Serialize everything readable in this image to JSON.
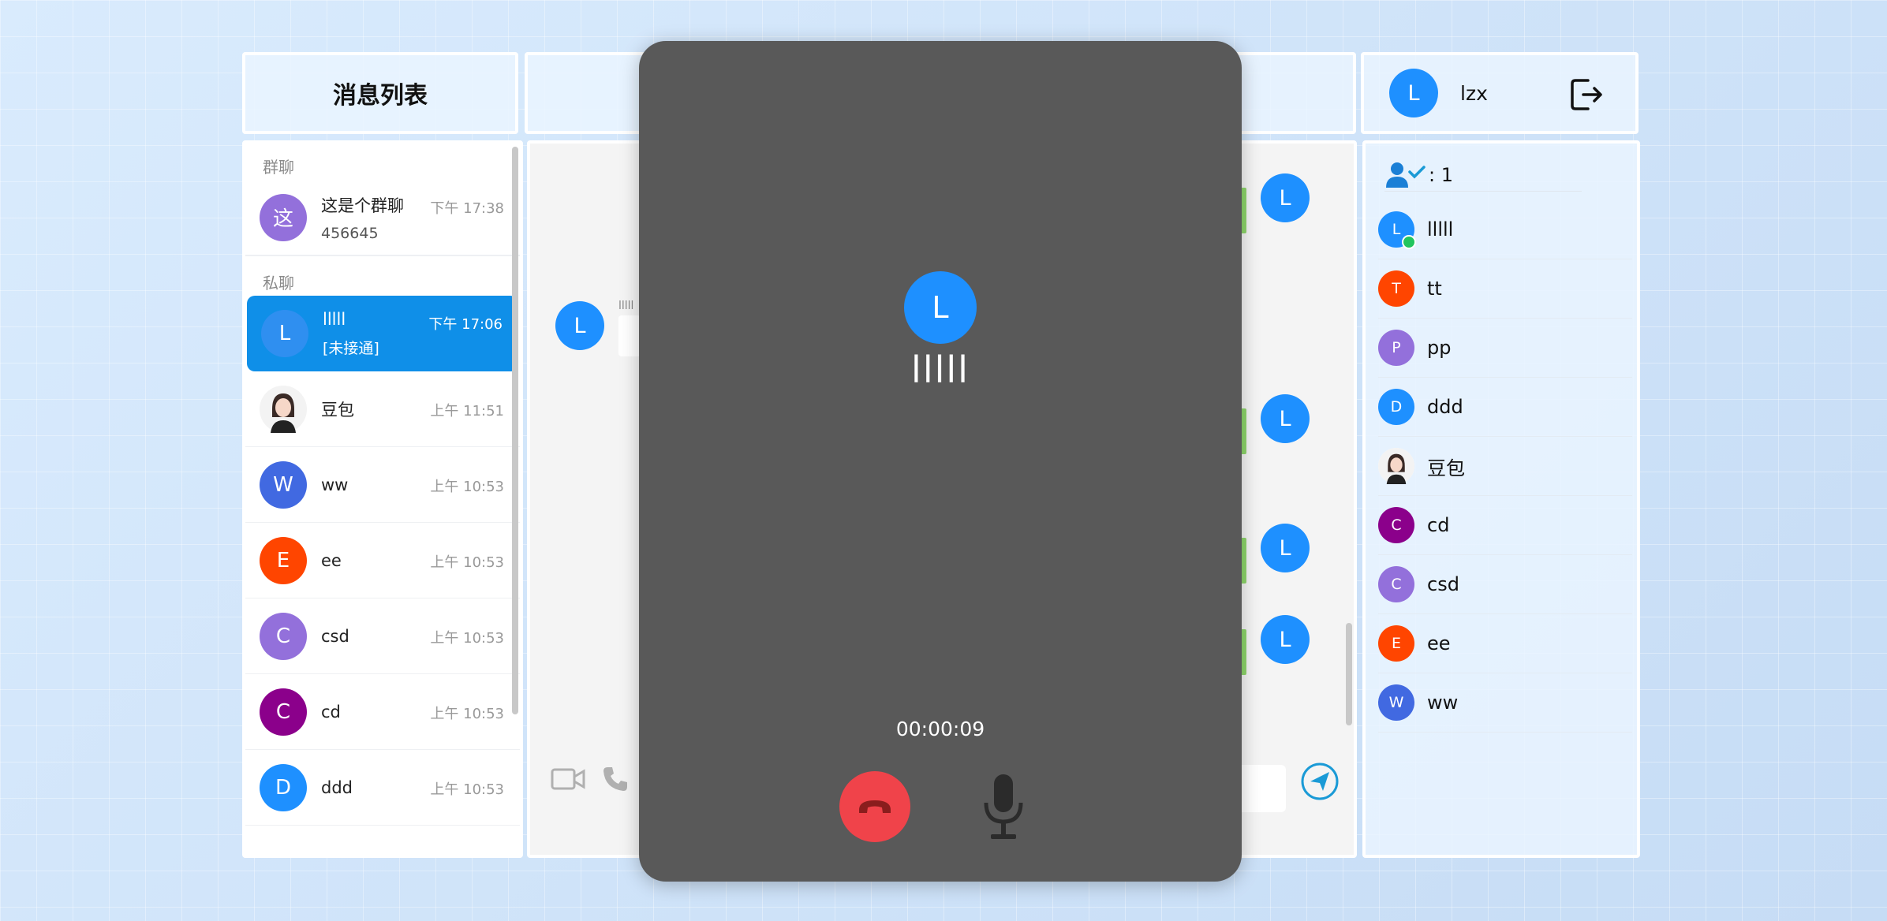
{
  "sidebar": {
    "title": "消息列表",
    "group_label": "群聊",
    "private_label": "私聊",
    "groups": [
      {
        "avatar": "这",
        "name": "这是个群聊",
        "preview": "456645",
        "time": "下午 17:38",
        "color": "#9370db"
      }
    ],
    "privates": [
      {
        "avatar": "L",
        "name": "lllll",
        "preview": "[未接通]",
        "time": "下午 17:06",
        "color": "#2f8ff0",
        "active": true
      },
      {
        "avatar": "",
        "name": "豆包",
        "preview": "",
        "time": "上午 11:51",
        "color": "#ffffff",
        "photo": true
      },
      {
        "avatar": "W",
        "name": "ww",
        "preview": "",
        "time": "上午 10:53",
        "color": "#4169e1"
      },
      {
        "avatar": "E",
        "name": "ee",
        "preview": "",
        "time": "上午 10:53",
        "color": "#ff4500"
      },
      {
        "avatar": "C",
        "name": "csd",
        "preview": "",
        "time": "上午 10:53",
        "color": "#9370db"
      },
      {
        "avatar": "C",
        "name": "cd",
        "preview": "",
        "time": "上午 10:53",
        "color": "#8b008b"
      },
      {
        "avatar": "D",
        "name": "ddd",
        "preview": "",
        "time": "上午 10:53",
        "color": "#1e90ff"
      }
    ]
  },
  "chat": {
    "peer_avatar": "L",
    "peer_name_small": "lllll",
    "my_avatar": "L",
    "icons": [
      "video-camera-icon",
      "phone-icon",
      "send-icon"
    ]
  },
  "user": {
    "avatar": "L",
    "name": "lzx",
    "logout_icon": "logout-icon"
  },
  "friends": {
    "online_count": ": 1",
    "items": [
      {
        "avatar": "L",
        "name": "lllll",
        "color": "#1e90ff",
        "online": true
      },
      {
        "avatar": "T",
        "name": "tt",
        "color": "#ff4500"
      },
      {
        "avatar": "P",
        "name": "pp",
        "color": "#9370db"
      },
      {
        "avatar": "D",
        "name": "ddd",
        "color": "#1e90ff"
      },
      {
        "avatar": "",
        "name": "豆包",
        "color": "#ffffff",
        "photo": true
      },
      {
        "avatar": "C",
        "name": "cd",
        "color": "#8b008b"
      },
      {
        "avatar": "C",
        "name": "csd",
        "color": "#9370db"
      },
      {
        "avatar": "E",
        "name": "ee",
        "color": "#ff4500"
      },
      {
        "avatar": "W",
        "name": "ww",
        "color": "#4169e1"
      }
    ]
  },
  "call": {
    "avatar": "L",
    "name": "lllll",
    "timer": "00:00:09",
    "hangup_color": "#f0434a",
    "background": "#595959"
  }
}
